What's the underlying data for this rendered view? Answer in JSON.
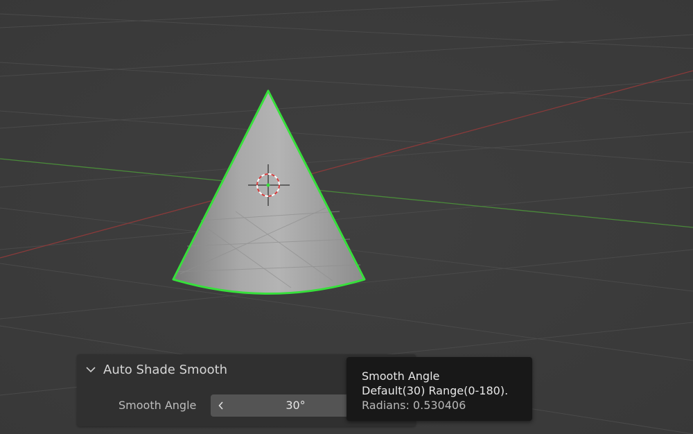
{
  "viewport": {
    "background_color": "#3d3d3d",
    "x_axis_color": "#8a3a3a",
    "y_axis_color": "#4a8a3a",
    "selection_outline_color": "#37e03b",
    "object": "cone"
  },
  "redo_panel": {
    "collapse_icon": "chevron-down-icon",
    "title": "Auto Shade Smooth",
    "smooth_angle_label": "Smooth Angle",
    "smooth_angle_value": "30°",
    "decrement_icon": "chevron-left-icon"
  },
  "tooltip": {
    "title": "Smooth Angle",
    "description": "Default(30) Range(0-180).",
    "python_info": "Radians: 0.530406"
  }
}
